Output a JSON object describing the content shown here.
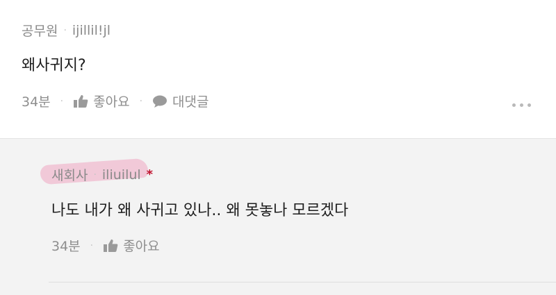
{
  "comment": {
    "company": "공무원",
    "separator": "·",
    "nickname": "ijillil!jl",
    "text": "왜사귀지?",
    "time": "34분",
    "like_label": "좋아요",
    "reply_label": "대댓글",
    "icons": [
      "thumbs-up-icon",
      "speech-bubble-icon",
      "more-dots-icon"
    ]
  },
  "reply": {
    "company": "새회사",
    "separator": "·",
    "nickname": "iliuilul",
    "author_mark": "*",
    "text": "나도 내가 왜 사귀고 있나.. 왜 못놓나 모르겠다",
    "time": "34분",
    "like_label": "좋아요",
    "icons": [
      "thumbs-up-icon"
    ]
  },
  "colors": {
    "meta_gray": "#8a8a8a",
    "reply_background": "#f3f3f3",
    "author_mark": "#c0112e",
    "highlight_pink": "#f096b9"
  }
}
